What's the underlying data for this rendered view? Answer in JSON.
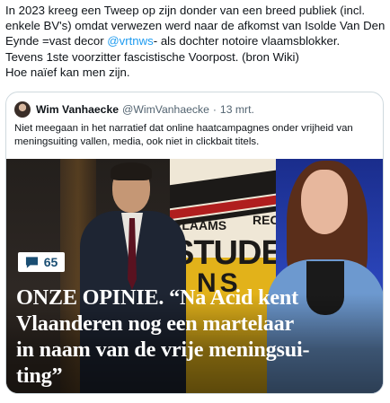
{
  "tweet": {
    "line1": "In 2023 kreeg een Tweep op zijn donder van een breed publiek (incl.",
    "line2": "enkele BV's) omdat verwezen werd naar de afkomst van Isolde Van Den",
    "line3_start": "Eynde =vast decor ",
    "mention": "@vrtnws",
    "line3_end": "- als dochter notoire vlaamsblokker.",
    "line4": "Tevens 1ste voorzitter fascistische Voorpost. (bron Wiki)",
    "line5": "Hoe naïef kan men zijn."
  },
  "quote": {
    "author_name": "Wim Vanhaecke",
    "author_handle": "@WimVanhaecke",
    "separator": "·",
    "date": "13 mrt.",
    "text_line1": "Niet meegaan in het narratief dat online haatcampagnes onder vrijheid van",
    "text_line2": "meningsuiting vallen, media, ook niet in clickbait titels.",
    "media": {
      "banner_word1": "VLAAMS",
      "banner_word2": "RECH",
      "banner_word3": "STUDEN",
      "banner_word4": "NS",
      "comment_count": "65",
      "headline_line1": "ONZE OPINIE. “Na Acid kent",
      "headline_line2": "Vlaanderen nog een martelaar",
      "headline_line3": "in naam van de vrije meningsui-",
      "headline_line4": "ting”"
    }
  },
  "icons": {
    "avatar": "avatar-photo",
    "comment": "speech-bubble-icon"
  },
  "colors": {
    "link": "#1d9bf0",
    "secondary_text": "#536471",
    "comment_icon": "#1a4e73",
    "headline_text": "#ffffff"
  }
}
